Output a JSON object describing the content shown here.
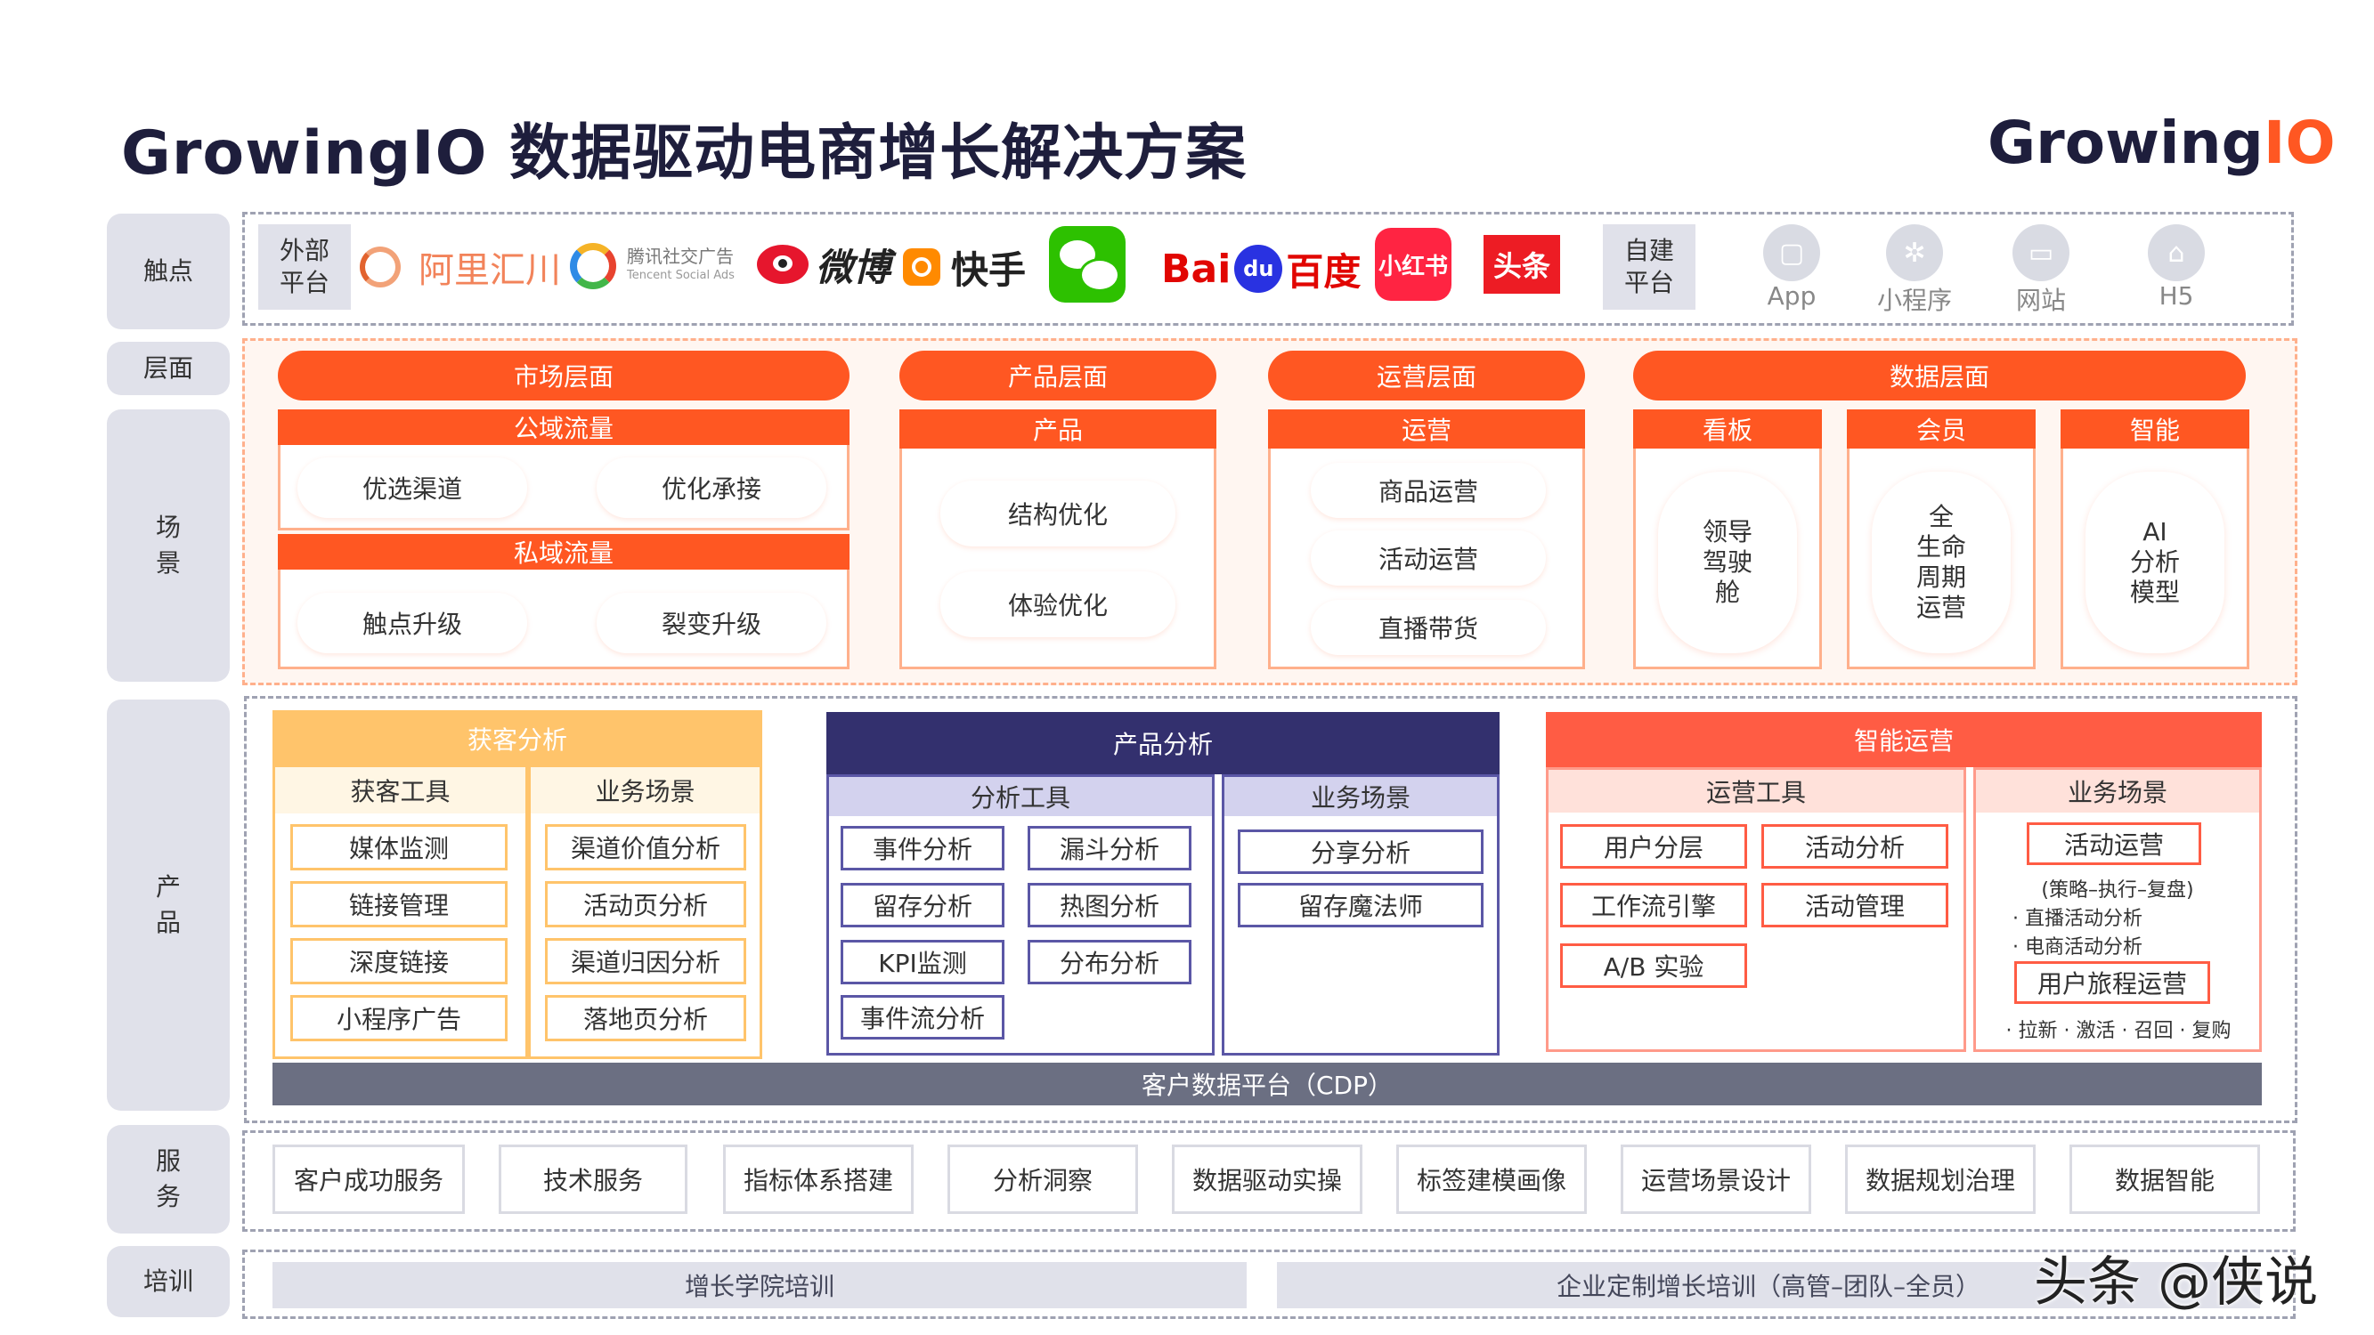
{
  "header": {
    "title": "GrowingIO 数据驱动电商增长解决方案",
    "logo_main": "Growing",
    "logo_accent": "IO"
  },
  "rows": {
    "touch": "触点",
    "layer": "层面",
    "scene": "场\n景",
    "product": "产\n品",
    "service": "服\n务",
    "training": "培训"
  },
  "touchpoints": {
    "external": "外部\n平台",
    "brands": {
      "ali": "阿里汇川",
      "tencent_1": "腾讯社交广告",
      "tencent_2": "Tencent Social Ads",
      "weibo": "微博",
      "kuaishou": "快手",
      "baidu_1": "Bai",
      "baidu_2": "du",
      "baidu_3": "百度",
      "xhs": "小红书",
      "toutiao": "头条"
    },
    "self": "自建\n平台",
    "self_items": [
      {
        "label": "App"
      },
      {
        "label": "小程序"
      },
      {
        "label": "网站"
      },
      {
        "label": "H5"
      }
    ]
  },
  "layers": {
    "market": {
      "title": "市场层面",
      "public": "公域流量",
      "private": "私域流量",
      "items": [
        "优选渠道",
        "优化承接",
        "触点升级",
        "裂变升级"
      ]
    },
    "product": {
      "title": "产品层面",
      "sub": "产品",
      "items": [
        "结构优化",
        "体验优化"
      ]
    },
    "ops": {
      "title": "运营层面",
      "sub": "运营",
      "items": [
        "商品运营",
        "活动运营",
        "直播带货"
      ]
    },
    "data": {
      "title": "数据层面",
      "cols": [
        {
          "title": "看板",
          "body": "领导\n驾驶\n舱"
        },
        {
          "title": "会员",
          "body": "全\n生命\n周期\n运营"
        },
        {
          "title": "智能",
          "body": "AI\n分析\n模型"
        }
      ]
    }
  },
  "products": {
    "acq": {
      "title": "获客分析",
      "tools_title": "获客工具",
      "scene_title": "业务场景",
      "tools": [
        "媒体监测",
        "链接管理",
        "深度链接",
        "小程序广告"
      ],
      "scenes": [
        "渠道价值分析",
        "活动页分析",
        "渠道归因分析",
        "落地页分析"
      ]
    },
    "prod": {
      "title": "产品分析",
      "tools_title": "分析工具",
      "scene_title": "业务场景",
      "tools": [
        "事件分析",
        "漏斗分析",
        "留存分析",
        "热图分析",
        "KPI监测",
        "分布分析",
        "事件流分析"
      ],
      "scenes": [
        "分享分析",
        "留存魔法师"
      ]
    },
    "smart": {
      "title": "智能运营",
      "tools_title": "运营工具",
      "scene_title": "业务场景",
      "tools": [
        "用户分层",
        "活动分析",
        "工作流引擎",
        "活动管理",
        "A/B 实验"
      ],
      "scene1": "活动运营",
      "scene1_note": "(策略–执行–复盘)",
      "scene1_b1": "· 直播活动分析",
      "scene1_b2": "· 电商活动分析",
      "scene2": "用户旅程运营",
      "scene2_note": "· 拉新 · 激活 · 召回 · 复购"
    },
    "cdp": "客户数据平台（CDP）"
  },
  "services": [
    "客户成功服务",
    "技术服务",
    "指标体系搭建",
    "分析洞察",
    "数据驱动实操",
    "标签建模画像",
    "运营场景设计",
    "数据规划治理",
    "数据智能"
  ],
  "training": [
    "增长学院培训",
    "企业定制增长培训（高管–团队–全员）"
  ],
  "watermark": "头条 @侠说",
  "colors": {
    "accent": "#ff5722",
    "navy": "#33306e",
    "yellow": "#ffc46b",
    "gray_bar": "#6b6f82"
  }
}
